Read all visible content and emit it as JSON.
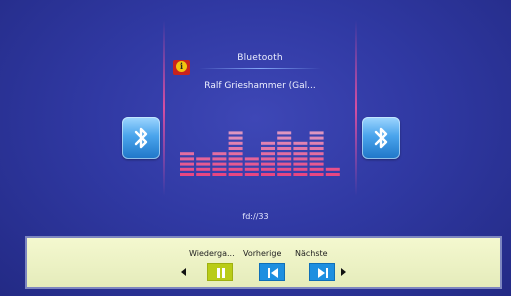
{
  "source": {
    "label": "Bluetooth"
  },
  "track": {
    "title": "Ralf Grieshammer (Gal..."
  },
  "path": {
    "label": "fd://33"
  },
  "equalizer": {
    "levels": [
      3,
      2,
      3,
      5,
      2,
      4,
      5,
      4,
      5,
      1
    ],
    "max_level": 5
  },
  "controls": {
    "play_pause_label": "Wiederga...",
    "prev_label": "Vorherige",
    "next_label": "Nächste"
  },
  "colors": {
    "background": "#3039a3",
    "accent_pink": "#e6509f",
    "bar_bg": "#eef3c6",
    "play_button": "#b9cc18",
    "nav_button": "#1e8fe0"
  }
}
